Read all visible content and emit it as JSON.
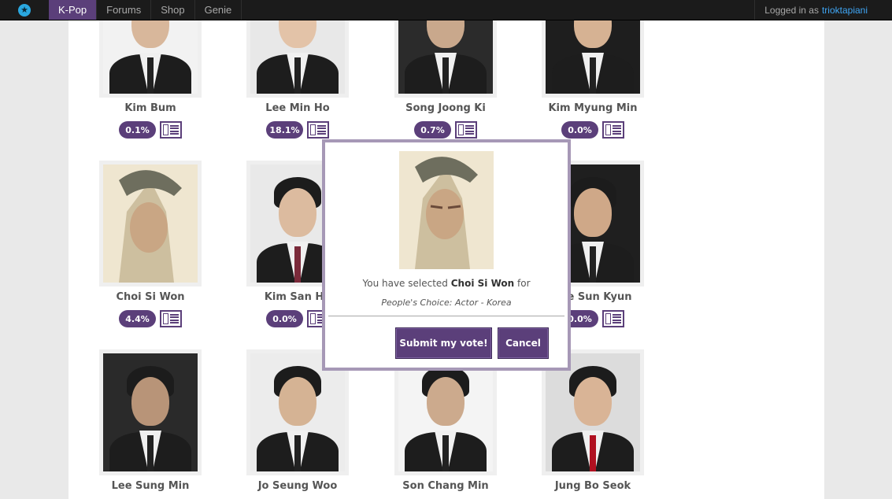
{
  "topbar": {
    "logo_icon": "star-badge-icon",
    "nav": [
      "K-Pop",
      "Forums",
      "Shop",
      "Genie"
    ],
    "active_nav": "K-Pop",
    "login_prefix": "Logged in as",
    "username": "trioktapiani"
  },
  "actors": [
    {
      "name": "Kim Bum",
      "percent": "0.1%"
    },
    {
      "name": "Lee Min Ho",
      "percent": "18.1%"
    },
    {
      "name": "Song Joong Ki",
      "percent": "0.7%"
    },
    {
      "name": "Kim Myung Min",
      "percent": "0.0%"
    },
    {
      "name": "Choi Si Won",
      "percent": "4.4%"
    },
    {
      "name": "Kim San Ho",
      "percent": "0.0%"
    },
    {
      "name": "",
      "percent": ""
    },
    {
      "name": "Lee Sun Kyun",
      "percent": "0.0%"
    },
    {
      "name": "Lee Sung Min",
      "percent": ""
    },
    {
      "name": "Jo Seung Woo",
      "percent": ""
    },
    {
      "name": "Son Chang Min",
      "percent": ""
    },
    {
      "name": "Jung Bo Seok",
      "percent": ""
    }
  ],
  "modal": {
    "prefix": "You have selected",
    "selected_name": "Choi Si Won",
    "suffix": "for",
    "category": "People's Choice: Actor - Korea",
    "submit_label": "Submit my vote!",
    "cancel_label": "Cancel"
  },
  "colors": {
    "accent": "#5b3f7a",
    "topbar": "#1b1b1b",
    "link": "#3fa6f5"
  }
}
